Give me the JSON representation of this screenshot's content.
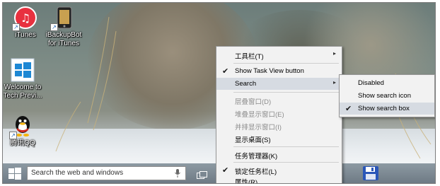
{
  "desktop_icons": [
    {
      "label": "iTunes",
      "icon": "itunes-icon"
    },
    {
      "label": "iBackupBot for iTunes",
      "icon": "ibackupbot-icon"
    },
    {
      "label": "Welcome to Tech Previ...",
      "icon": "windows-logo-icon"
    },
    {
      "label": "腾讯QQ",
      "icon": "qq-penguin-icon"
    }
  ],
  "taskbar": {
    "search_placeholder": "Search the web and windows",
    "icons": [
      "windows-start-icon",
      "microphone-icon",
      "task-view-icon",
      "floppy-disk-icon"
    ]
  },
  "context_menu": {
    "items": [
      {
        "label": "工具栏(T)",
        "checked": false,
        "submenu": true
      },
      {
        "label": "Show Task View button",
        "checked": true
      },
      {
        "label": "Search",
        "submenu": true,
        "highlighted": true
      },
      {
        "label": "层叠窗口(D)",
        "disabled": true
      },
      {
        "label": "堆叠显示窗口(E)",
        "disabled": true
      },
      {
        "label": "并排显示窗口(I)",
        "disabled": true
      },
      {
        "label": "显示桌面(S)"
      },
      {
        "label": "任务管理器(K)"
      },
      {
        "label": "锁定任务栏(L)",
        "checked": true
      },
      {
        "label": "属性(R)"
      }
    ]
  },
  "search_submenu": {
    "items": [
      {
        "label": "Disabled",
        "checked": false
      },
      {
        "label": "Show search icon",
        "checked": false
      },
      {
        "label": "Show search box",
        "checked": true
      }
    ]
  },
  "symbols": {
    "check": "✔",
    "arrow": "▸"
  },
  "colors": {
    "menu_bg": "#f2f2f2",
    "highlight": "#d6dbe2",
    "taskbar": "#7b8791"
  }
}
